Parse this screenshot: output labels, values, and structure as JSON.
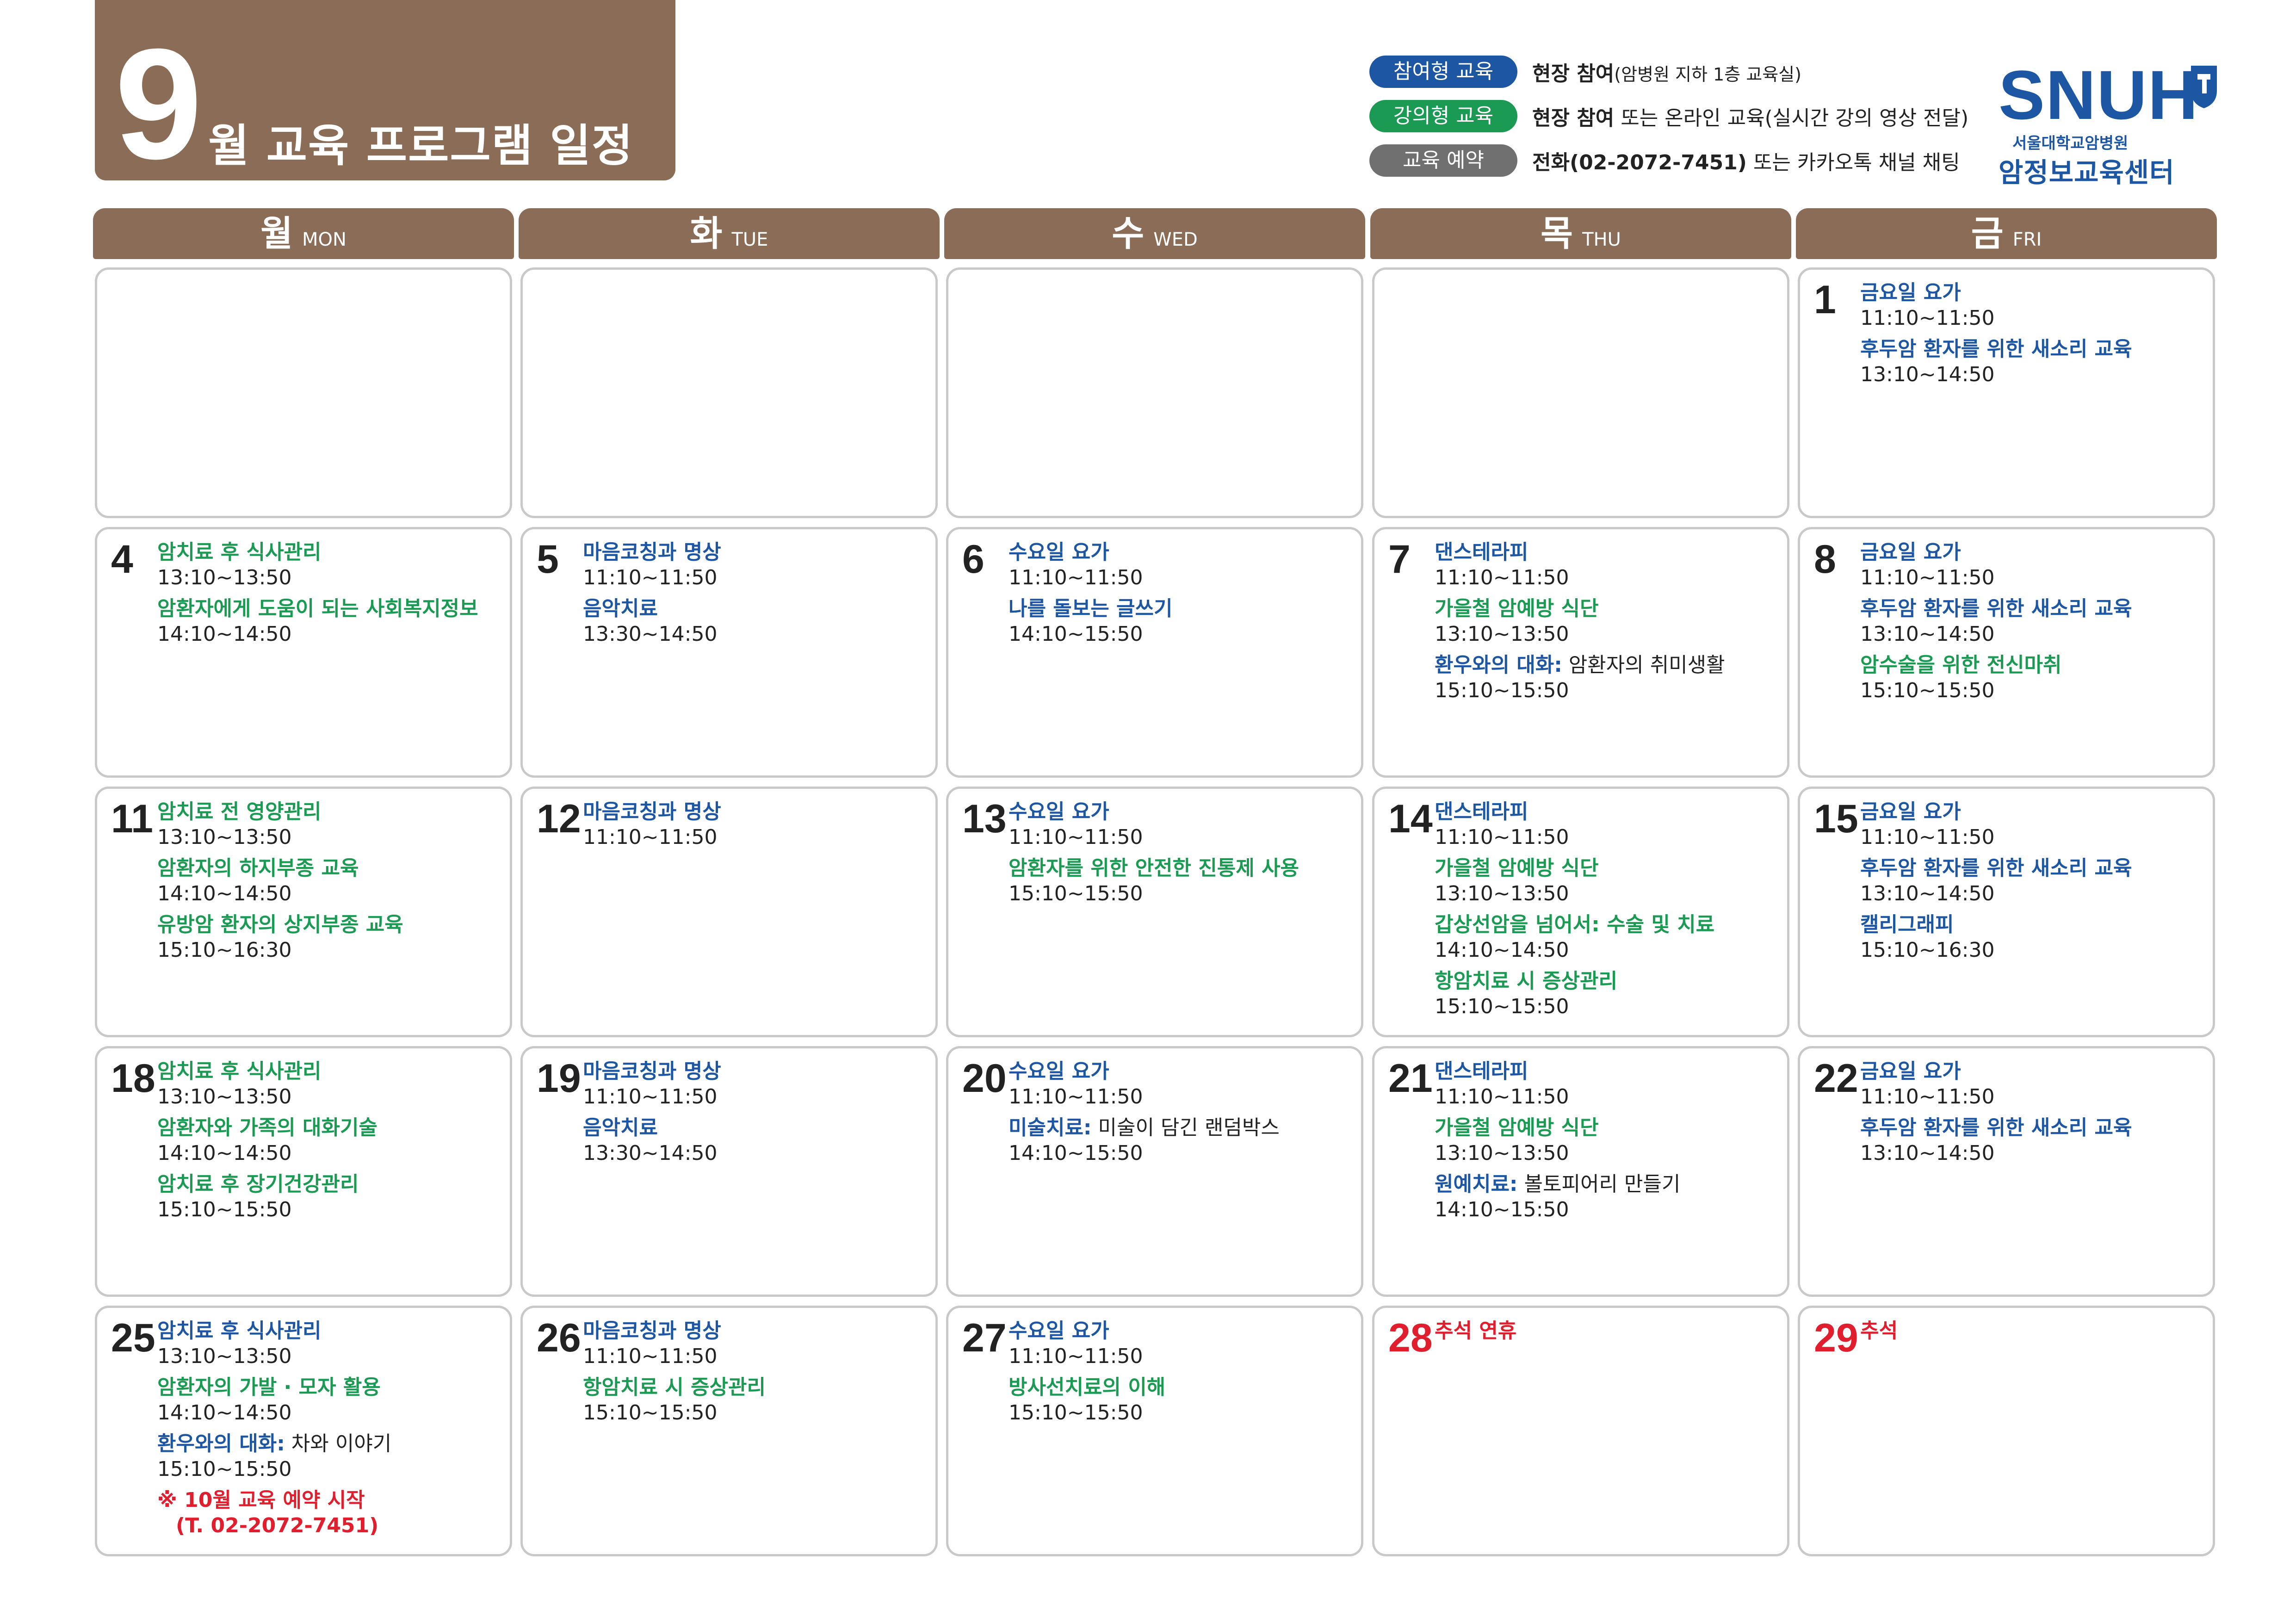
{
  "title": {
    "month_number": "9",
    "text": "월 교육 프로그램 일정"
  },
  "legend": [
    {
      "label": "참여형 교육",
      "color": "blue",
      "bold": "현장 참여",
      "rest": "(암병원 지하 1층 교육실)"
    },
    {
      "label": "강의형 교육",
      "color": "green",
      "bold": "현장 참여",
      "rest": " 또는 온라인 교육(실시간 강의 영상 전달)"
    },
    {
      "label": "교육 예약",
      "color": "gray",
      "bold": "전화(02-2072-7451)",
      "rest": " 또는 카카오톡 채널 채팅"
    }
  ],
  "logo": {
    "main": "SNUH",
    "sub": "서울대학교암병원",
    "center": "암정보교육센터"
  },
  "colors": {
    "brown": "#8a6c57",
    "blue": "#1d56a2",
    "green": "#1a9a52",
    "red": "#e01e2e",
    "gray": "#707070"
  },
  "days": [
    {
      "ko": "월",
      "en": "MON"
    },
    {
      "ko": "화",
      "en": "TUE"
    },
    {
      "ko": "수",
      "en": "WED"
    },
    {
      "ko": "목",
      "en": "THU"
    },
    {
      "ko": "금",
      "en": "FRI"
    }
  ],
  "weeks": [
    [
      {
        "date": "",
        "events": []
      },
      {
        "date": "",
        "events": []
      },
      {
        "date": "",
        "events": []
      },
      {
        "date": "",
        "events": []
      },
      {
        "date": "1",
        "events": [
          {
            "title": "금요일 요가",
            "color": "blue",
            "time": "11:10~11:50"
          },
          {
            "title": "후두암 환자를 위한 새소리 교육",
            "color": "blue",
            "time": "13:10~14:50"
          }
        ]
      }
    ],
    [
      {
        "date": "4",
        "events": [
          {
            "title": "암치료 후 식사관리",
            "color": "green",
            "time": "13:10~13:50"
          },
          {
            "title": "암환자에게 도움이 되는 사회복지정보",
            "color": "green",
            "time": "14:10~14:50"
          }
        ]
      },
      {
        "date": "5",
        "events": [
          {
            "title": "마음코칭과 명상",
            "color": "blue",
            "time": "11:10~11:50"
          },
          {
            "title": "음악치료",
            "color": "blue",
            "time": "13:30~14:50"
          }
        ]
      },
      {
        "date": "6",
        "events": [
          {
            "title": "수요일 요가",
            "color": "blue",
            "time": "11:10~11:50"
          },
          {
            "title": "나를 돌보는 글쓰기",
            "color": "blue",
            "time": "14:10~15:50"
          }
        ]
      },
      {
        "date": "7",
        "events": [
          {
            "title": "댄스테라피",
            "color": "blue",
            "time": "11:10~11:50"
          },
          {
            "title": "가을철 암예방 식단",
            "color": "green",
            "time": "13:10~13:50"
          },
          {
            "title": "환우와의 대화:",
            "color": "blue",
            "desc": " 암환자의 취미생활",
            "time": "15:10~15:50"
          }
        ]
      },
      {
        "date": "8",
        "events": [
          {
            "title": "금요일 요가",
            "color": "blue",
            "time": "11:10~11:50"
          },
          {
            "title": "후두암 환자를 위한 새소리 교육",
            "color": "blue",
            "time": "13:10~14:50"
          },
          {
            "title": "암수술을 위한 전신마취",
            "color": "green",
            "time": "15:10~15:50"
          }
        ]
      }
    ],
    [
      {
        "date": "11",
        "events": [
          {
            "title": "암치료 전 영양관리",
            "color": "green",
            "time": "13:10~13:50"
          },
          {
            "title": "암환자의 하지부종 교육",
            "color": "green",
            "time": "14:10~14:50"
          },
          {
            "title": "유방암 환자의 상지부종 교육",
            "color": "green",
            "time": "15:10~16:30"
          }
        ]
      },
      {
        "date": "12",
        "events": [
          {
            "title": "마음코칭과 명상",
            "color": "blue",
            "time": "11:10~11:50"
          }
        ]
      },
      {
        "date": "13",
        "events": [
          {
            "title": "수요일 요가",
            "color": "blue",
            "time": "11:10~11:50"
          },
          {
            "title": "암환자를 위한 안전한 진통제 사용",
            "color": "green",
            "time": "15:10~15:50"
          }
        ]
      },
      {
        "date": "14",
        "events": [
          {
            "title": "댄스테라피",
            "color": "blue",
            "time": "11:10~11:50"
          },
          {
            "title": "가을철 암예방 식단",
            "color": "green",
            "time": "13:10~13:50"
          },
          {
            "title": "갑상선암을 넘어서: 수술 및 치료",
            "color": "green",
            "time": "14:10~14:50"
          },
          {
            "title": "항암치료 시 증상관리",
            "color": "green",
            "time": "15:10~15:50"
          }
        ]
      },
      {
        "date": "15",
        "events": [
          {
            "title": "금요일 요가",
            "color": "blue",
            "time": "11:10~11:50"
          },
          {
            "title": "후두암 환자를 위한 새소리 교육",
            "color": "blue",
            "time": "13:10~14:50"
          },
          {
            "title": "캘리그래피",
            "color": "blue",
            "time": "15:10~16:30"
          }
        ]
      }
    ],
    [
      {
        "date": "18",
        "events": [
          {
            "title": "암치료 후 식사관리",
            "color": "green",
            "time": "13:10~13:50"
          },
          {
            "title": "암환자와 가족의 대화기술",
            "color": "green",
            "time": "14:10~14:50"
          },
          {
            "title": "암치료 후 장기건강관리",
            "color": "green",
            "time": "15:10~15:50"
          }
        ]
      },
      {
        "date": "19",
        "events": [
          {
            "title": "마음코칭과 명상",
            "color": "blue",
            "time": "11:10~11:50"
          },
          {
            "title": "음악치료",
            "color": "blue",
            "time": "13:30~14:50"
          }
        ]
      },
      {
        "date": "20",
        "events": [
          {
            "title": "수요일 요가",
            "color": "blue",
            "time": "11:10~11:50"
          },
          {
            "title": "미술치료:",
            "color": "blue",
            "desc": " 미술이 담긴 랜덤박스",
            "time": "14:10~15:50"
          }
        ]
      },
      {
        "date": "21",
        "events": [
          {
            "title": "댄스테라피",
            "color": "blue",
            "time": "11:10~11:50"
          },
          {
            "title": "가을철 암예방 식단",
            "color": "green",
            "time": "13:10~13:50"
          },
          {
            "title": "원예치료:",
            "color": "blue",
            "desc": " 볼토피어리 만들기",
            "time": "14:10~15:50"
          }
        ]
      },
      {
        "date": "22",
        "events": [
          {
            "title": "금요일 요가",
            "color": "blue",
            "time": "11:10~11:50"
          },
          {
            "title": "후두암 환자를 위한 새소리 교육",
            "color": "blue",
            "time": "13:10~14:50"
          }
        ]
      }
    ],
    [
      {
        "date": "25",
        "events": [
          {
            "title": "암치료 후 식사관리",
            "color": "blue",
            "time": "13:10~13:50"
          },
          {
            "title": "암환자의 가발 · 모자 활용",
            "color": "green",
            "time": "14:10~14:50"
          },
          {
            "title": "환우와의 대화:",
            "color": "blue",
            "desc": " 차와 이야기",
            "time": "15:10~15:50"
          },
          {
            "title": "※ 10월 교육 예약 시작",
            "color": "red",
            "time": "(T. 02-2072-7451)",
            "time_color": "red"
          }
        ]
      },
      {
        "date": "26",
        "events": [
          {
            "title": "마음코칭과 명상",
            "color": "blue",
            "time": "11:10~11:50"
          },
          {
            "title": "항암치료 시 증상관리",
            "color": "green",
            "time": "15:10~15:50"
          }
        ]
      },
      {
        "date": "27",
        "events": [
          {
            "title": "수요일 요가",
            "color": "blue",
            "time": "11:10~11:50"
          },
          {
            "title": "방사선치료의 이해",
            "color": "green",
            "time": "15:10~15:50"
          }
        ]
      },
      {
        "date": "28",
        "date_color": "red",
        "events": [
          {
            "title": "추석 연휴",
            "color": "red"
          }
        ]
      },
      {
        "date": "29",
        "date_color": "red",
        "events": [
          {
            "title": "추석",
            "color": "red"
          }
        ]
      }
    ]
  ]
}
